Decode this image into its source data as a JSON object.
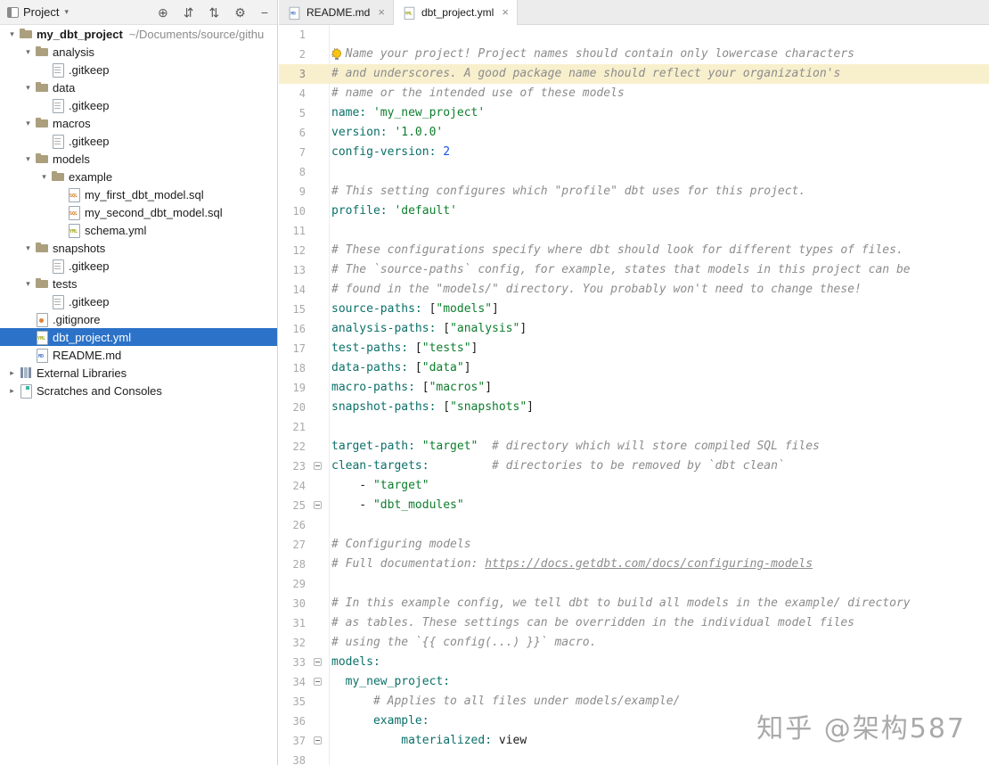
{
  "sidebar": {
    "header": {
      "title": "Project",
      "chevron": "▾",
      "actions": [
        {
          "name": "locate-file-icon",
          "glyph": "⊕"
        },
        {
          "name": "expand-all-icon",
          "glyph": "⇵"
        },
        {
          "name": "collapse-all-icon",
          "glyph": "⇅"
        },
        {
          "name": "settings-gear-icon",
          "glyph": "⚙"
        },
        {
          "name": "hide-panel-icon",
          "glyph": "−"
        }
      ]
    },
    "tree": [
      {
        "label": "my_dbt_project",
        "path": "~/Documents/source/githu",
        "icon": "folder",
        "level": 0,
        "expand": "open",
        "bold": true
      },
      {
        "label": "analysis",
        "icon": "folder",
        "level": 1,
        "expand": "open"
      },
      {
        "label": ".gitkeep",
        "icon": "file",
        "level": 2,
        "expand": "none"
      },
      {
        "label": "data",
        "icon": "folder",
        "level": 1,
        "expand": "open"
      },
      {
        "label": ".gitkeep",
        "icon": "file",
        "level": 2,
        "expand": "none"
      },
      {
        "label": "macros",
        "icon": "folder",
        "level": 1,
        "expand": "open"
      },
      {
        "label": ".gitkeep",
        "icon": "file",
        "level": 2,
        "expand": "none"
      },
      {
        "label": "models",
        "icon": "folder",
        "level": 1,
        "expand": "open"
      },
      {
        "label": "example",
        "icon": "folder",
        "level": 2,
        "expand": "open"
      },
      {
        "label": "my_first_dbt_model.sql",
        "icon": "sql",
        "level": 3,
        "expand": "none"
      },
      {
        "label": "my_second_dbt_model.sql",
        "icon": "sql",
        "level": 3,
        "expand": "none"
      },
      {
        "label": "schema.yml",
        "icon": "yml",
        "level": 3,
        "expand": "none"
      },
      {
        "label": "snapshots",
        "icon": "folder",
        "level": 1,
        "expand": "open"
      },
      {
        "label": ".gitkeep",
        "icon": "file",
        "level": 2,
        "expand": "none"
      },
      {
        "label": "tests",
        "icon": "folder",
        "level": 1,
        "expand": "open"
      },
      {
        "label": ".gitkeep",
        "icon": "file",
        "level": 2,
        "expand": "none"
      },
      {
        "label": ".gitignore",
        "icon": "git",
        "level": 1,
        "expand": "none"
      },
      {
        "label": "dbt_project.yml",
        "icon": "yml",
        "level": 1,
        "expand": "none",
        "selected": true
      },
      {
        "label": "README.md",
        "icon": "md",
        "level": 1,
        "expand": "none"
      },
      {
        "label": "External Libraries",
        "icon": "lib",
        "level": 0,
        "expand": "closed"
      },
      {
        "label": "Scratches and Consoles",
        "icon": "scratch",
        "level": 0,
        "expand": "closed"
      }
    ]
  },
  "editor": {
    "tabs": [
      {
        "label": "README.md",
        "icon": "md",
        "active": false,
        "close": "×"
      },
      {
        "label": "dbt_project.yml",
        "icon": "yml",
        "active": true,
        "close": "×"
      }
    ],
    "lines": [
      {
        "n": 1,
        "seg": []
      },
      {
        "n": 2,
        "bulb": true,
        "seg": [
          {
            "c": "c",
            "t": "# Name your project! Project names should contain only lowercase characters"
          }
        ]
      },
      {
        "n": 3,
        "active": true,
        "seg": [
          {
            "c": "c",
            "t": "# and underscores. A good package name should reflect your organization's"
          }
        ]
      },
      {
        "n": 4,
        "seg": [
          {
            "c": "c",
            "t": "# name or the intended use of these models"
          }
        ]
      },
      {
        "n": 5,
        "seg": [
          {
            "c": "k",
            "t": "name:"
          },
          {
            "c": "d",
            "t": " "
          },
          {
            "c": "s",
            "t": "'my_new_project'"
          }
        ]
      },
      {
        "n": 6,
        "seg": [
          {
            "c": "k",
            "t": "version:"
          },
          {
            "c": "d",
            "t": " "
          },
          {
            "c": "s",
            "t": "'1.0.0'"
          }
        ]
      },
      {
        "n": 7,
        "seg": [
          {
            "c": "k",
            "t": "config-version:"
          },
          {
            "c": "d",
            "t": " "
          },
          {
            "c": "n",
            "t": "2"
          }
        ]
      },
      {
        "n": 8,
        "seg": []
      },
      {
        "n": 9,
        "seg": [
          {
            "c": "c",
            "t": "# This setting configures which \"profile\" dbt uses for this project."
          }
        ]
      },
      {
        "n": 10,
        "seg": [
          {
            "c": "k",
            "t": "profile:"
          },
          {
            "c": "d",
            "t": " "
          },
          {
            "c": "s",
            "t": "'default'"
          }
        ]
      },
      {
        "n": 11,
        "seg": []
      },
      {
        "n": 12,
        "seg": [
          {
            "c": "c",
            "t": "# These configurations specify where dbt should look for different types of files."
          }
        ]
      },
      {
        "n": 13,
        "seg": [
          {
            "c": "c",
            "t": "# The `source-paths` config, for example, states that models in this project can be"
          }
        ]
      },
      {
        "n": 14,
        "seg": [
          {
            "c": "c",
            "t": "# found in the \"models/\" directory. You probably won't need to change these!"
          }
        ]
      },
      {
        "n": 15,
        "seg": [
          {
            "c": "k",
            "t": "source-paths:"
          },
          {
            "c": "d",
            "t": " ["
          },
          {
            "c": "s",
            "t": "\"models\""
          },
          {
            "c": "d",
            "t": "]"
          }
        ]
      },
      {
        "n": 16,
        "seg": [
          {
            "c": "k",
            "t": "analysis-paths:"
          },
          {
            "c": "d",
            "t": " ["
          },
          {
            "c": "s",
            "t": "\"analysis\""
          },
          {
            "c": "d",
            "t": "]"
          }
        ]
      },
      {
        "n": 17,
        "seg": [
          {
            "c": "k",
            "t": "test-paths:"
          },
          {
            "c": "d",
            "t": " ["
          },
          {
            "c": "s",
            "t": "\"tests\""
          },
          {
            "c": "d",
            "t": "]"
          }
        ]
      },
      {
        "n": 18,
        "seg": [
          {
            "c": "k",
            "t": "data-paths:"
          },
          {
            "c": "d",
            "t": " ["
          },
          {
            "c": "s",
            "t": "\"data\""
          },
          {
            "c": "d",
            "t": "]"
          }
        ]
      },
      {
        "n": 19,
        "seg": [
          {
            "c": "k",
            "t": "macro-paths:"
          },
          {
            "c": "d",
            "t": " ["
          },
          {
            "c": "s",
            "t": "\"macros\""
          },
          {
            "c": "d",
            "t": "]"
          }
        ]
      },
      {
        "n": 20,
        "seg": [
          {
            "c": "k",
            "t": "snapshot-paths:"
          },
          {
            "c": "d",
            "t": " ["
          },
          {
            "c": "s",
            "t": "\"snapshots\""
          },
          {
            "c": "d",
            "t": "]"
          }
        ]
      },
      {
        "n": 21,
        "seg": []
      },
      {
        "n": 22,
        "seg": [
          {
            "c": "k",
            "t": "target-path:"
          },
          {
            "c": "d",
            "t": " "
          },
          {
            "c": "s",
            "t": "\"target\""
          },
          {
            "c": "c",
            "t": "  # directory which will store compiled SQL files"
          }
        ]
      },
      {
        "n": 23,
        "fold": true,
        "seg": [
          {
            "c": "k",
            "t": "clean-targets:"
          },
          {
            "c": "c",
            "t": "         # directories to be removed by `dbt clean`"
          }
        ]
      },
      {
        "n": 24,
        "seg": [
          {
            "c": "d",
            "t": "    - "
          },
          {
            "c": "s",
            "t": "\"target\""
          }
        ]
      },
      {
        "n": 25,
        "fold": true,
        "seg": [
          {
            "c": "d",
            "t": "    - "
          },
          {
            "c": "s",
            "t": "\"dbt_modules\""
          }
        ]
      },
      {
        "n": 26,
        "seg": []
      },
      {
        "n": 27,
        "seg": [
          {
            "c": "c",
            "t": "# Configuring models"
          }
        ]
      },
      {
        "n": 28,
        "seg": [
          {
            "c": "c",
            "t": "# Full documentation: "
          },
          {
            "c": "l",
            "t": "https://docs.getdbt.com/docs/configuring-models"
          }
        ]
      },
      {
        "n": 29,
        "seg": []
      },
      {
        "n": 30,
        "seg": [
          {
            "c": "c",
            "t": "# In this example config, we tell dbt to build all models in the example/ directory"
          }
        ]
      },
      {
        "n": 31,
        "seg": [
          {
            "c": "c",
            "t": "# as tables. These settings can be overridden in the individual model files"
          }
        ]
      },
      {
        "n": 32,
        "seg": [
          {
            "c": "c",
            "t": "# using the `{{ config(...) }}` macro."
          }
        ]
      },
      {
        "n": 33,
        "fold": true,
        "seg": [
          {
            "c": "k",
            "t": "models:"
          }
        ]
      },
      {
        "n": 34,
        "fold": true,
        "seg": [
          {
            "c": "d",
            "t": "  "
          },
          {
            "c": "k",
            "t": "my_new_project:"
          }
        ]
      },
      {
        "n": 35,
        "seg": [
          {
            "c": "d",
            "t": "      "
          },
          {
            "c": "c",
            "t": "# Applies to all files under models/example/"
          }
        ]
      },
      {
        "n": 36,
        "seg": [
          {
            "c": "d",
            "t": "      "
          },
          {
            "c": "k",
            "t": "example:"
          }
        ]
      },
      {
        "n": 37,
        "fold": true,
        "seg": [
          {
            "c": "d",
            "t": "          "
          },
          {
            "c": "k",
            "t": "materialized:"
          },
          {
            "c": "d",
            "t": " view"
          }
        ]
      },
      {
        "n": 38,
        "seg": []
      }
    ]
  },
  "watermark": {
    "text": "知乎 @架构587"
  },
  "colors": {
    "selection_blue": "#2b72c8",
    "active_line_highlight": "#f8efcd",
    "yaml_key": "#0b7069",
    "string_green": "#0d7d2c",
    "number_blue": "#1750eb",
    "comment_gray": "#8c8c8c"
  }
}
